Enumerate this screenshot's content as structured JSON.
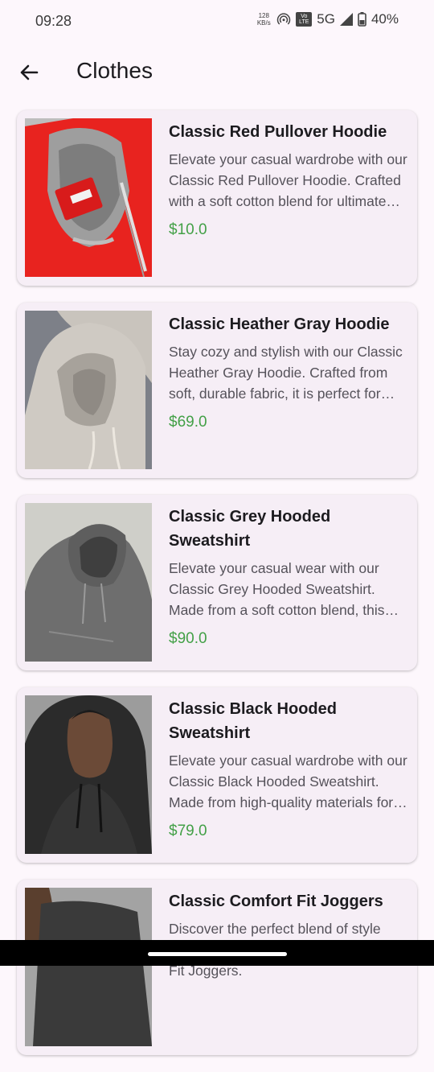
{
  "status_bar": {
    "time": "09:28",
    "net_speed_value": "128",
    "net_speed_unit": "KB/s",
    "volte_top": "Vo",
    "volte_bottom": "LTE",
    "network": "5G",
    "battery": "40%"
  },
  "app_bar": {
    "back_icon": "arrow-left-icon",
    "title": "Clothes"
  },
  "colors": {
    "background": "#fdf7fc",
    "card": "#f6eef6",
    "price": "#43a047"
  },
  "products": [
    {
      "name": "Classic Red Pullover Hoodie",
      "description": "Elevate your casual wardrobe with our Classic Red Pullover Hoodie. Crafted with a soft cotton blend for ultimate comfort.",
      "price": "$10.0",
      "image": "red-hoodie-photo"
    },
    {
      "name": "Classic Heather Gray Hoodie",
      "description": "Stay cozy and stylish with our Classic Heather Gray Hoodie. Crafted from soft, durable fabric, it is perfect for everyday wear.",
      "price": "$69.0",
      "image": "gray-hoodie-photo"
    },
    {
      "name": "Classic Grey Hooded Sweatshirt",
      "description": "Elevate your casual wear with our Classic Grey Hooded Sweatshirt. Made from a soft cotton blend, this hoodie is perfect for cool days.",
      "price": "$90.0",
      "image": "grey-sweatshirt-photo"
    },
    {
      "name": "Classic Black Hooded Sweatshirt",
      "description": "Elevate your casual wardrobe with our Classic Black Hooded Sweatshirt. Made from high-quality materials for lasting comfort.",
      "price": "$79.0",
      "image": "black-sweatshirt-photo"
    },
    {
      "name": "Classic Comfort Fit Joggers",
      "description": "Discover the perfect blend of style and comfort with our Classic Comfort Fit Joggers.",
      "price": "",
      "image": "joggers-photo"
    }
  ]
}
